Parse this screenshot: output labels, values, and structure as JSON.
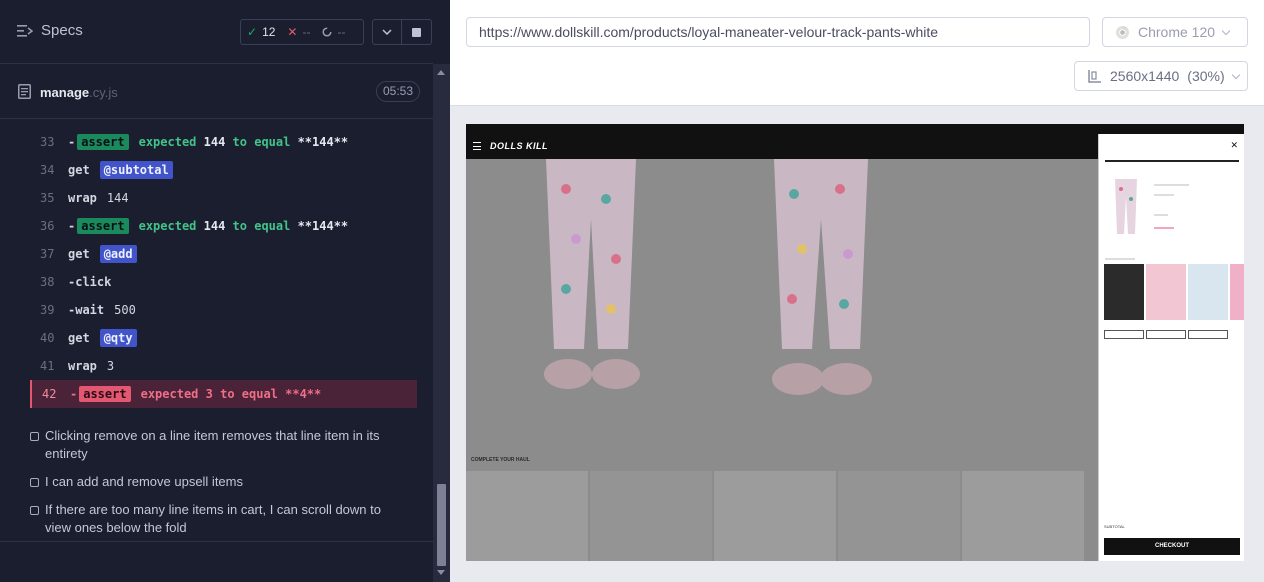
{
  "reporter": {
    "specs_label": "Specs",
    "stats": {
      "passed": "12",
      "failed": "--",
      "pending": "--"
    },
    "file": {
      "name": "manage",
      "ext": ".cy.js",
      "duration": "05:53"
    },
    "commands": [
      {
        "num": "33",
        "type": "assert",
        "badge": "assert",
        "expected": "expected",
        "actual": "144",
        "to_equal": "to equal",
        "value": "**144**",
        "state": "passed"
      },
      {
        "num": "34",
        "type": "get",
        "name": "get",
        "alias": "@subtotal"
      },
      {
        "num": "35",
        "type": "wrap",
        "name": "wrap",
        "msg": "144"
      },
      {
        "num": "36",
        "type": "assert",
        "badge": "assert",
        "expected": "expected",
        "actual": "144",
        "to_equal": "to equal",
        "value": "**144**",
        "state": "passed"
      },
      {
        "num": "37",
        "type": "get",
        "name": "get",
        "alias": "@add"
      },
      {
        "num": "38",
        "type": "child",
        "name": "click",
        "msg": ""
      },
      {
        "num": "39",
        "type": "child",
        "name": "wait",
        "msg": "500"
      },
      {
        "num": "40",
        "type": "get",
        "name": "get",
        "alias": "@qty"
      },
      {
        "num": "41",
        "type": "wrap",
        "name": "wrap",
        "msg": "3"
      },
      {
        "num": "42",
        "type": "assert",
        "badge": "assert",
        "expected": "expected",
        "actual": "3",
        "to_equal": "to equal",
        "value": "**4**",
        "state": "failed"
      }
    ],
    "tests": [
      {
        "title": "Clicking remove on a line item removes that line item in its entirety"
      },
      {
        "title": "I can add and remove upsell items"
      },
      {
        "title": "If there are too many line items in cart, I can scroll down to view ones below the fold"
      }
    ]
  },
  "aut": {
    "url": "https://www.dollskill.com/products/loyal-maneater-velour-track-pants-white",
    "browser": "Chrome 120",
    "viewport": "2560x1440",
    "zoom": "(30%)",
    "site": {
      "logo": "DOLLS KILL",
      "haul_label": "COMPLETE YOUR HAUL",
      "checkout_label": "CHECKOUT",
      "subtotal_label": "SUBTOTAL"
    }
  },
  "colors": {
    "pass": "#1fa971",
    "fail": "#e45770",
    "alias": "#4154c9"
  }
}
